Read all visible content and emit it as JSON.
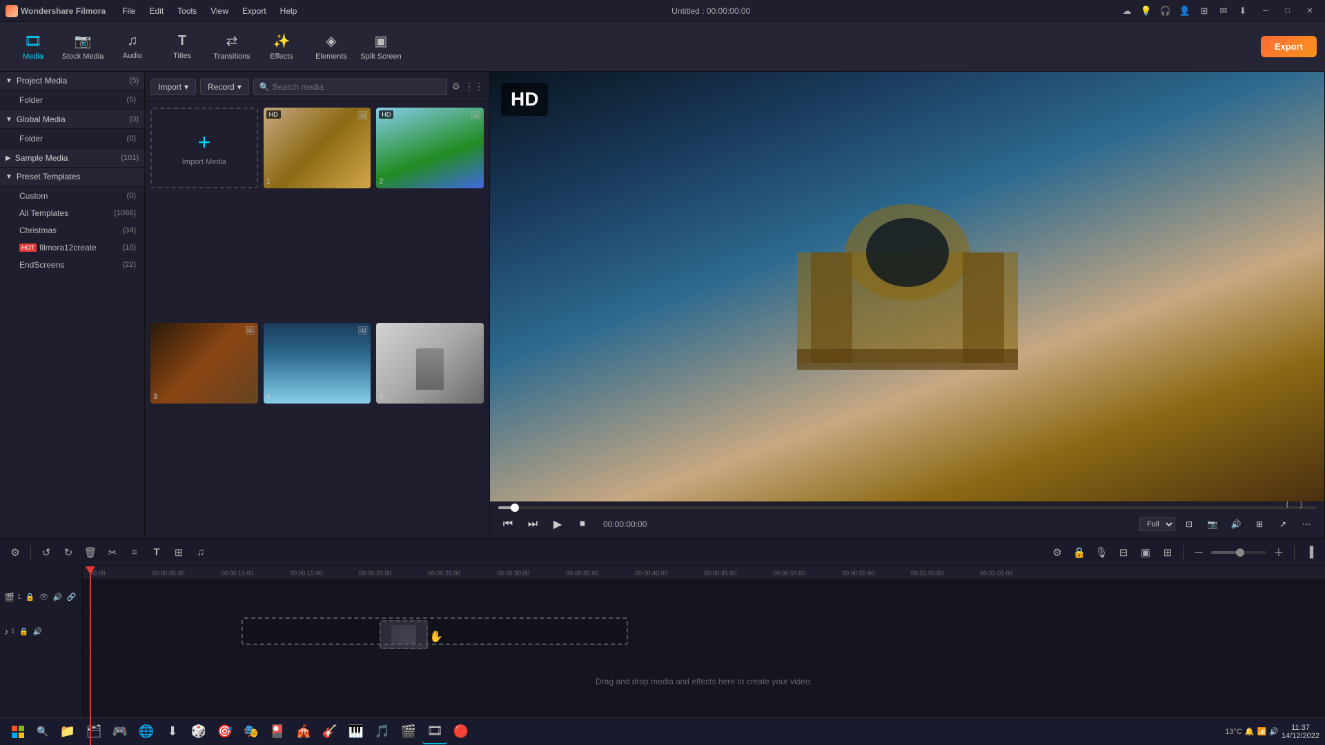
{
  "app": {
    "name": "Wondershare Filmora",
    "title": "Untitled : 00:00:00:00",
    "logo_icon": "🎬"
  },
  "menu": {
    "items": [
      "File",
      "Edit",
      "Tools",
      "View",
      "Export",
      "Help"
    ]
  },
  "toolbar": {
    "items": [
      {
        "id": "media",
        "label": "Media",
        "icon": "🎞"
      },
      {
        "id": "stock",
        "label": "Stock Media",
        "icon": "📷"
      },
      {
        "id": "audio",
        "label": "Audio",
        "icon": "♪"
      },
      {
        "id": "titles",
        "label": "Titles",
        "icon": "T"
      },
      {
        "id": "transitions",
        "label": "Transitions",
        "icon": "⇄"
      },
      {
        "id": "effects",
        "label": "Effects",
        "icon": "✨"
      },
      {
        "id": "elements",
        "label": "Elements",
        "icon": "◈"
      },
      {
        "id": "split",
        "label": "Split Screen",
        "icon": "▣"
      }
    ],
    "export_label": "Export"
  },
  "sidebar": {
    "sections": [
      {
        "id": "project-media",
        "label": "Project Media",
        "count": "5",
        "expanded": true,
        "children": [
          {
            "id": "folder",
            "label": "Folder",
            "count": "5",
            "hot": false
          }
        ]
      },
      {
        "id": "global-media",
        "label": "Global Media",
        "count": "0",
        "expanded": true,
        "children": [
          {
            "id": "folder-global",
            "label": "Folder",
            "count": "0",
            "hot": false
          }
        ]
      },
      {
        "id": "sample-media",
        "label": "Sample Media",
        "count": "101",
        "expanded": false,
        "children": []
      },
      {
        "id": "preset-templates",
        "label": "Preset Templates",
        "count": "",
        "expanded": true,
        "children": [
          {
            "id": "custom",
            "label": "Custom",
            "count": "0",
            "hot": false
          },
          {
            "id": "all-templates",
            "label": "All Templates",
            "count": "1086",
            "hot": false
          },
          {
            "id": "christmas",
            "label": "Christmas",
            "count": "34",
            "hot": false
          },
          {
            "id": "filmora12create",
            "label": "filmora12create",
            "count": "10",
            "hot": true
          },
          {
            "id": "endscreens",
            "label": "EndScreens",
            "count": "22",
            "hot": false
          }
        ]
      }
    ]
  },
  "media_panel": {
    "import_label": "Import",
    "record_label": "Record",
    "search_placeholder": "Search media",
    "items": [
      {
        "id": "import",
        "type": "import",
        "label": "Import Media"
      },
      {
        "id": "1",
        "type": "video",
        "label": "1",
        "hd": true,
        "thumb": "arc"
      },
      {
        "id": "2",
        "type": "video",
        "label": "2",
        "hd": true,
        "thumb": "eiffel"
      },
      {
        "id": "3",
        "type": "video",
        "label": "3",
        "hd": false,
        "thumb": "dark"
      },
      {
        "id": "4",
        "type": "video",
        "label": "4",
        "hd": false,
        "thumb": "mountain"
      },
      {
        "id": "5",
        "type": "video",
        "label": "5",
        "hd": false,
        "thumb": "paris"
      }
    ]
  },
  "preview": {
    "hd_label": "HD",
    "time_display": "00:00:00:00",
    "quality": "Full",
    "playback_controls": [
      "⏮",
      "⏭",
      "▶",
      "⏹"
    ]
  },
  "timeline": {
    "drag_drop_text": "Drag and drop media and effects here to create your video.",
    "time_marks": [
      "00:00",
      "00:00:05:00",
      "00:00:10:00",
      "00:00:15:00",
      "00:00:20:00",
      "00:00:25:00",
      "00:00:30:00",
      "00:00:35:00",
      "00:00:40:00",
      "00:00:45:00",
      "00:00:50:00",
      "00:00:55:00",
      "00:01:00:00",
      "00:01:05:00"
    ]
  },
  "taskbar": {
    "time": "11:37",
    "date": "14/12/2022",
    "temp": "13°C"
  }
}
